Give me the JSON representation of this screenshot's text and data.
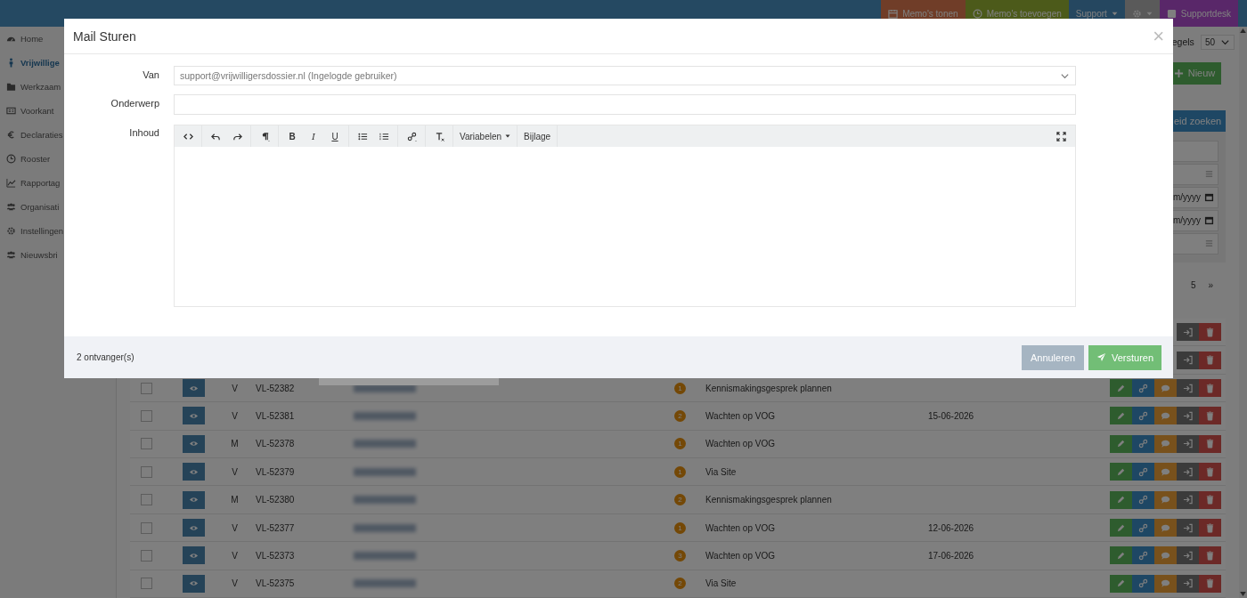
{
  "navbar": {
    "buttons": [
      {
        "kind": "memo-list",
        "label": "Memo's tonen"
      },
      {
        "kind": "memo-add",
        "label": "Memo's toevoegen"
      },
      {
        "kind": "menu",
        "label": "Support",
        "dropdown": true
      },
      {
        "kind": "settings",
        "dropdown": true
      },
      {
        "kind": "link",
        "label": "Supportdesk"
      }
    ]
  },
  "sidebar": {
    "items": [
      {
        "kind": "dashboard",
        "label": "Home",
        "selected": false
      },
      {
        "kind": "person",
        "label": "Vrijwillige",
        "selected": true
      },
      {
        "kind": "folder",
        "label": "Werkzaam",
        "selected": false
      },
      {
        "kind": "card",
        "label": "Voorkant",
        "selected": false
      },
      {
        "kind": "euro",
        "label": "Declaraties",
        "selected": false
      },
      {
        "kind": "clock",
        "label": "Rooster",
        "selected": false
      },
      {
        "kind": "chart",
        "label": "Rapportag",
        "selected": false
      },
      {
        "kind": "group",
        "label": "Organisati",
        "selected": false
      },
      {
        "kind": "gear",
        "label": "Instellingen",
        "selected": false
      },
      {
        "kind": "group",
        "label": "Nieuwsbri",
        "selected": false
      }
    ]
  },
  "toolbar": {
    "rows_label": "egels",
    "rows_per_page": "50",
    "new_button": "Nieuw"
  },
  "filter_panel": {
    "search_button": "eid zoeken",
    "fields": [
      {
        "kind": "text"
      },
      {
        "kind": "select"
      },
      {
        "kind": "date",
        "placeholder": "m/yyyy"
      },
      {
        "kind": "date",
        "placeholder": "m/yyyy"
      },
      {
        "kind": "select"
      }
    ]
  },
  "pagination": {
    "pages": [
      "5"
    ],
    "next": "»"
  },
  "table": {
    "rows": [
      {
        "kind": "covered"
      },
      {
        "kind": "covered"
      },
      {
        "kind": "row",
        "checked": false,
        "gender": "V",
        "id": "VL-52382",
        "badge": "1",
        "status": "Kennismakingsgesprek plannen"
      },
      {
        "kind": "row",
        "checked": false,
        "gender": "V",
        "id": "VL-52381",
        "badge": "2",
        "status": "Wachten op VOG",
        "date": "15-06-2026"
      },
      {
        "kind": "row",
        "checked": false,
        "gender": "M",
        "id": "VL-52378",
        "badge": "1",
        "status": "Wachten op VOG"
      },
      {
        "kind": "row",
        "checked": false,
        "gender": "V",
        "id": "VL-52379",
        "badge": "1",
        "status": "Via Site"
      },
      {
        "kind": "row",
        "checked": false,
        "gender": "M",
        "id": "VL-52380",
        "badge": "2",
        "status": "Kennismakingsgesprek plannen"
      },
      {
        "kind": "row",
        "checked": false,
        "gender": "V",
        "id": "VL-52377",
        "badge": "1",
        "status": "Wachten op VOG",
        "date": "12-06-2026"
      },
      {
        "kind": "row",
        "checked": false,
        "gender": "V",
        "id": "VL-52373",
        "badge": "3",
        "status": "Wachten op VOG",
        "date": "17-06-2026"
      },
      {
        "kind": "row",
        "checked": false,
        "gender": "V",
        "id": "VL-52375",
        "badge": "2",
        "status": "Via Site"
      }
    ]
  },
  "modal": {
    "title": "Mail Sturen",
    "close": "×",
    "from": {
      "label": "Van",
      "value": "support@vrijwilligersdossier.nl (Ingelogde gebruiker)"
    },
    "subject": {
      "label": "Onderwerp"
    },
    "body": {
      "label": "Inhoud"
    },
    "editor_toolbar": [
      [
        {
          "kind": "code"
        }
      ],
      [
        {
          "kind": "undo"
        },
        {
          "kind": "redo"
        }
      ],
      [
        {
          "kind": "paragraph"
        }
      ],
      [
        {
          "kind": "bold",
          "label": "B"
        },
        {
          "kind": "italic",
          "label": "I"
        },
        {
          "kind": "underline",
          "label": "U"
        }
      ],
      [
        {
          "kind": "bullets"
        },
        {
          "kind": "numbers"
        }
      ],
      [
        {
          "kind": "link"
        }
      ],
      [
        {
          "kind": "clear"
        }
      ],
      [
        {
          "kind": "dropdown",
          "label": "Variabelen"
        }
      ],
      [
        {
          "kind": "button",
          "label": "Bijlage"
        }
      ]
    ],
    "footer_text": "2 ontvanger(s)",
    "buttons": [
      {
        "kind": "cancel",
        "label": "Annuleren"
      },
      {
        "kind": "send",
        "label": "Versturen"
      }
    ]
  }
}
